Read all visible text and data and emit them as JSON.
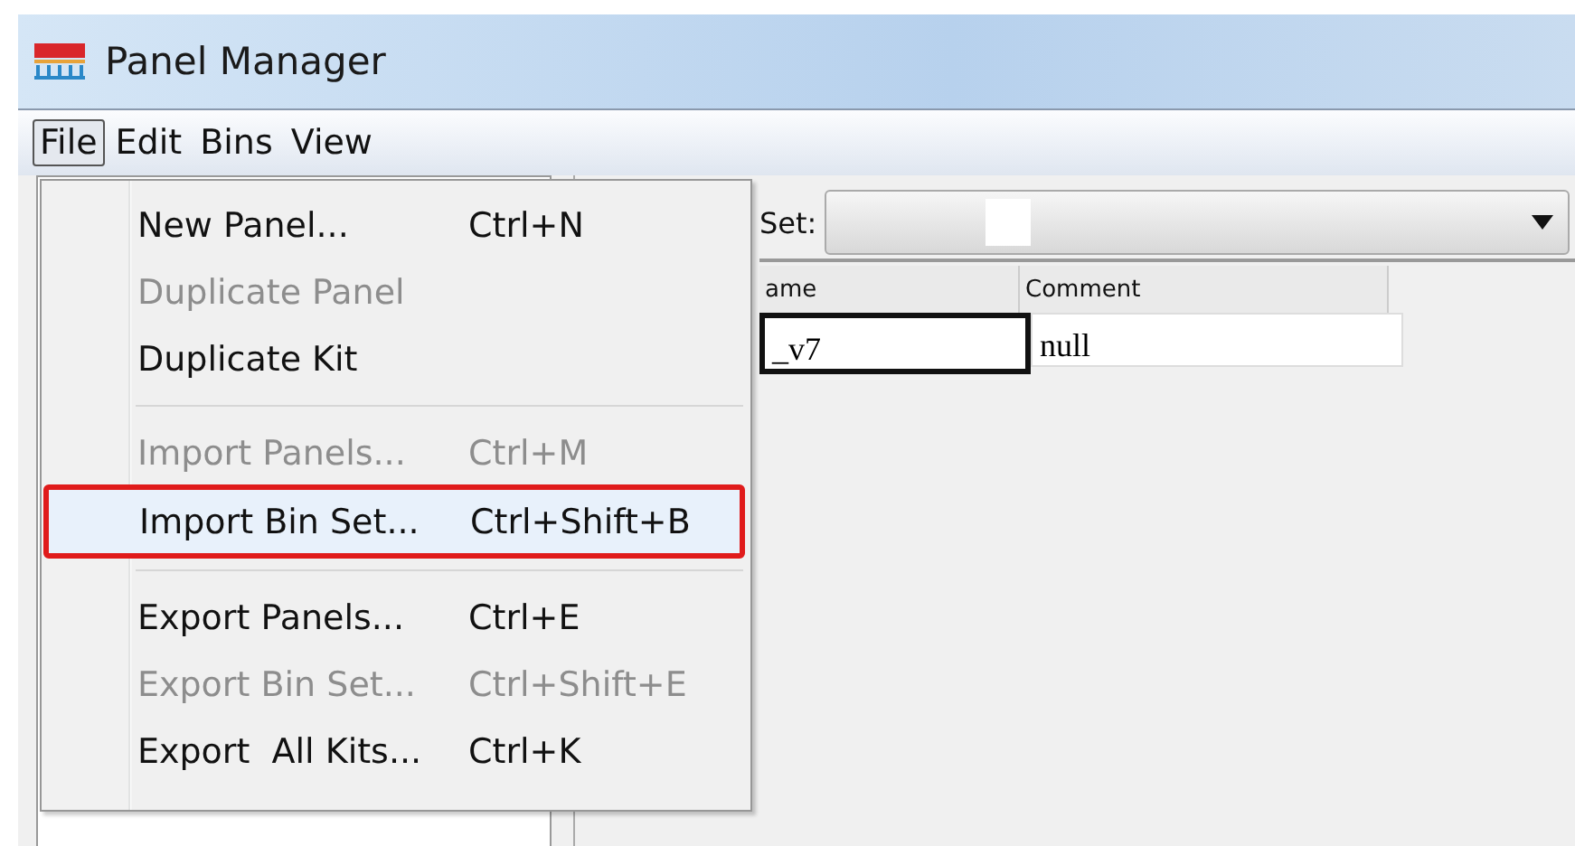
{
  "window": {
    "title": "Panel Manager"
  },
  "menubar": [
    {
      "label": "File",
      "selected": true
    },
    {
      "label": "Edit",
      "selected": false
    },
    {
      "label": "Bins",
      "selected": false
    },
    {
      "label": "View",
      "selected": false
    }
  ],
  "file_menu": [
    {
      "kind": "item",
      "label": "New Panel...",
      "shortcut": "Ctrl+N",
      "disabled": false,
      "selected": false,
      "highlighted": false
    },
    {
      "kind": "item",
      "label": "Duplicate Panel",
      "disabled": true,
      "selected": false,
      "highlighted": false
    },
    {
      "kind": "item",
      "label": "Duplicate Kit",
      "disabled": false,
      "selected": false,
      "highlighted": false
    },
    {
      "kind": "separator"
    },
    {
      "kind": "item",
      "label": "Import Panels...",
      "shortcut": "Ctrl+M",
      "disabled": true,
      "selected": false,
      "highlighted": false
    },
    {
      "kind": "item",
      "label": "Import Bin Set...",
      "shortcut": "Ctrl+Shift+B",
      "disabled": false,
      "selected": true,
      "highlighted": true
    },
    {
      "kind": "separator"
    },
    {
      "kind": "item",
      "label": "Export Panels...",
      "shortcut": "Ctrl+E",
      "disabled": false,
      "selected": false,
      "highlighted": false
    },
    {
      "kind": "item",
      "label": "Export Bin Set...",
      "shortcut": "Ctrl+Shift+E",
      "disabled": true,
      "selected": false,
      "highlighted": false
    },
    {
      "kind": "item",
      "label": "Export  All Kits...",
      "shortcut": "Ctrl+K",
      "disabled": false,
      "selected": false,
      "highlighted": false
    }
  ],
  "bin_set": {
    "label": "Set:"
  },
  "table": {
    "columns": [
      "ame",
      "Comment"
    ],
    "rows": [
      {
        "cells": [
          "_v7",
          "null"
        ],
        "selected": true
      }
    ]
  }
}
